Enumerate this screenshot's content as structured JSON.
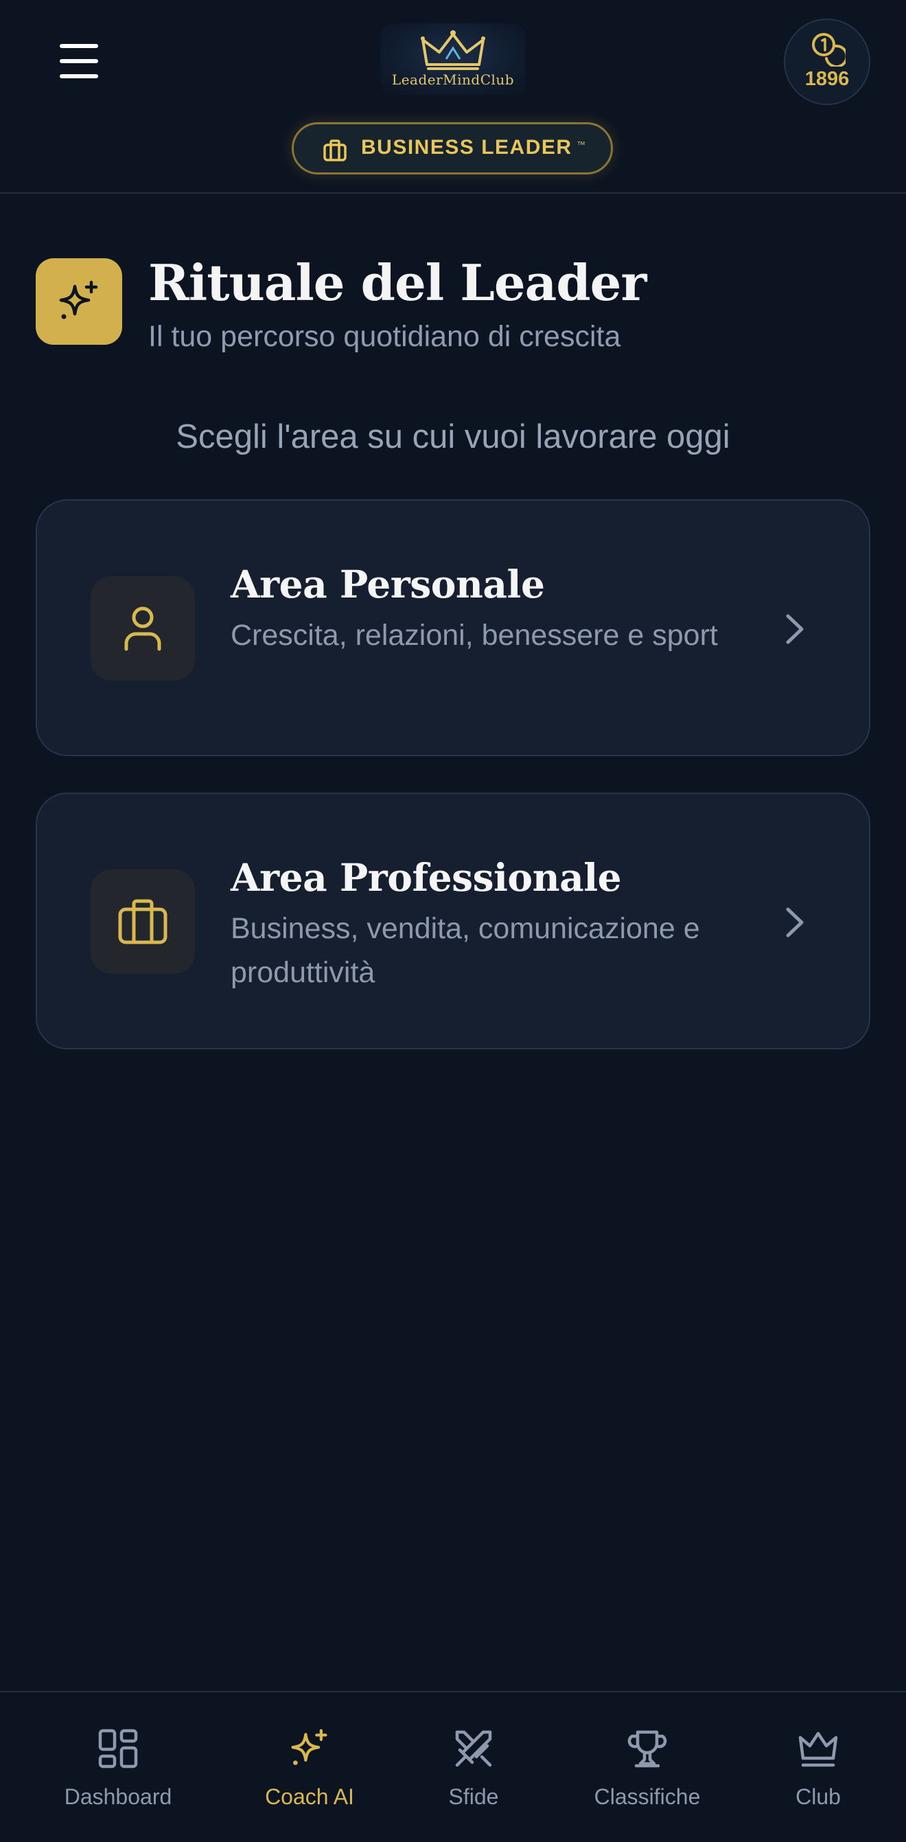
{
  "header": {
    "menu_icon": "hamburger-menu-icon",
    "logo": {
      "icon": "crown-icon",
      "text": "LeaderMindClub"
    },
    "coins": {
      "icon": "coins-icon",
      "count": "1896"
    },
    "badge": {
      "icon": "briefcase-icon",
      "label": "BUSINESS LEADER",
      "mark": "™"
    }
  },
  "page": {
    "icon": "sparkles-icon",
    "title": "Rituale del Leader",
    "subtitle": "Il tuo percorso quotidiano di crescita",
    "prompt": "Scegli l'area su cui vuoi lavorare oggi"
  },
  "areas": [
    {
      "icon": "user-icon",
      "title": "Area Personale",
      "description": "Crescita, relazioni, benessere e sport"
    },
    {
      "icon": "briefcase-icon",
      "title": "Area Professionale",
      "description": "Business, vendita, comunicazione e produttività"
    }
  ],
  "nav": {
    "items": [
      {
        "label": "Dashboard",
        "icon": "dashboard-grid-icon"
      },
      {
        "label": "Coach AI",
        "icon": "sparkles-icon",
        "active": true
      },
      {
        "label": "Sfide",
        "icon": "crossed-swords-icon"
      },
      {
        "label": "Classifiche",
        "icon": "trophy-icon"
      },
      {
        "label": "Club",
        "icon": "crown-icon"
      }
    ]
  },
  "colors": {
    "background": "#0c1421",
    "card": "#161f2f",
    "accent_gold": "#d9b84f",
    "muted_text": "#8e99ad"
  }
}
